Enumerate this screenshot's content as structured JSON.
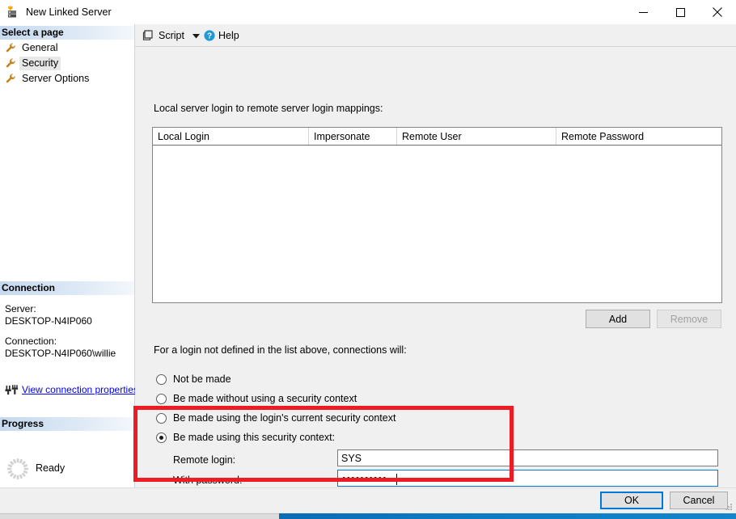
{
  "window": {
    "title": "New Linked Server",
    "icon": "linked-server-icon",
    "minimize_label": "Minimize",
    "maximize_label": "Maximize",
    "close_label": "Close"
  },
  "sidebar": {
    "select_page_header": "Select a page",
    "pages": [
      {
        "label": "General",
        "icon": "wrench-icon",
        "selected": false
      },
      {
        "label": "Security",
        "icon": "wrench-icon",
        "selected": true
      },
      {
        "label": "Server Options",
        "icon": "wrench-icon",
        "selected": false
      }
    ],
    "connection_header": "Connection",
    "server_label": "Server:",
    "server_value": "DESKTOP-N4IP060",
    "connection_label": "Connection:",
    "connection_value": "DESKTOP-N4IP060\\willie",
    "view_connection_link": "View connection properties",
    "view_connection_icon": "plug-icon",
    "progress_header": "Progress",
    "progress_icon": "spinner-icon",
    "progress_status": "Ready"
  },
  "toolbar": {
    "script_label": "Script",
    "script_icon": "script-icon",
    "script_dropdown_icon": "chevron-down-icon",
    "help_label": "Help",
    "help_icon": "help-circle-icon"
  },
  "main": {
    "mappings_caption": "Local server login to remote server login mappings:",
    "table": {
      "columns": [
        "Local Login",
        "Impersonate",
        "Remote User",
        "Remote Password"
      ],
      "rows": []
    },
    "add_label": "Add",
    "remove_label": "Remove",
    "remove_enabled": false,
    "for_login_caption": "For a login not defined in the list above, connections will:",
    "options": [
      {
        "label": "Not be made",
        "selected": false
      },
      {
        "label": "Be made without using a security context",
        "selected": false
      },
      {
        "label": "Be made using the login's current security context",
        "selected": false
      },
      {
        "label": "Be made using this security context:",
        "selected": true
      }
    ],
    "remote_login_label": "Remote login:",
    "remote_login_value": "SYS",
    "with_password_label": "With password:",
    "with_password_masked": "••••••••••",
    "highlight_color": "#ed1c24"
  },
  "footer": {
    "ok_label": "OK",
    "cancel_label": "Cancel",
    "resize_grip_icon": "resize-grip-icon"
  }
}
